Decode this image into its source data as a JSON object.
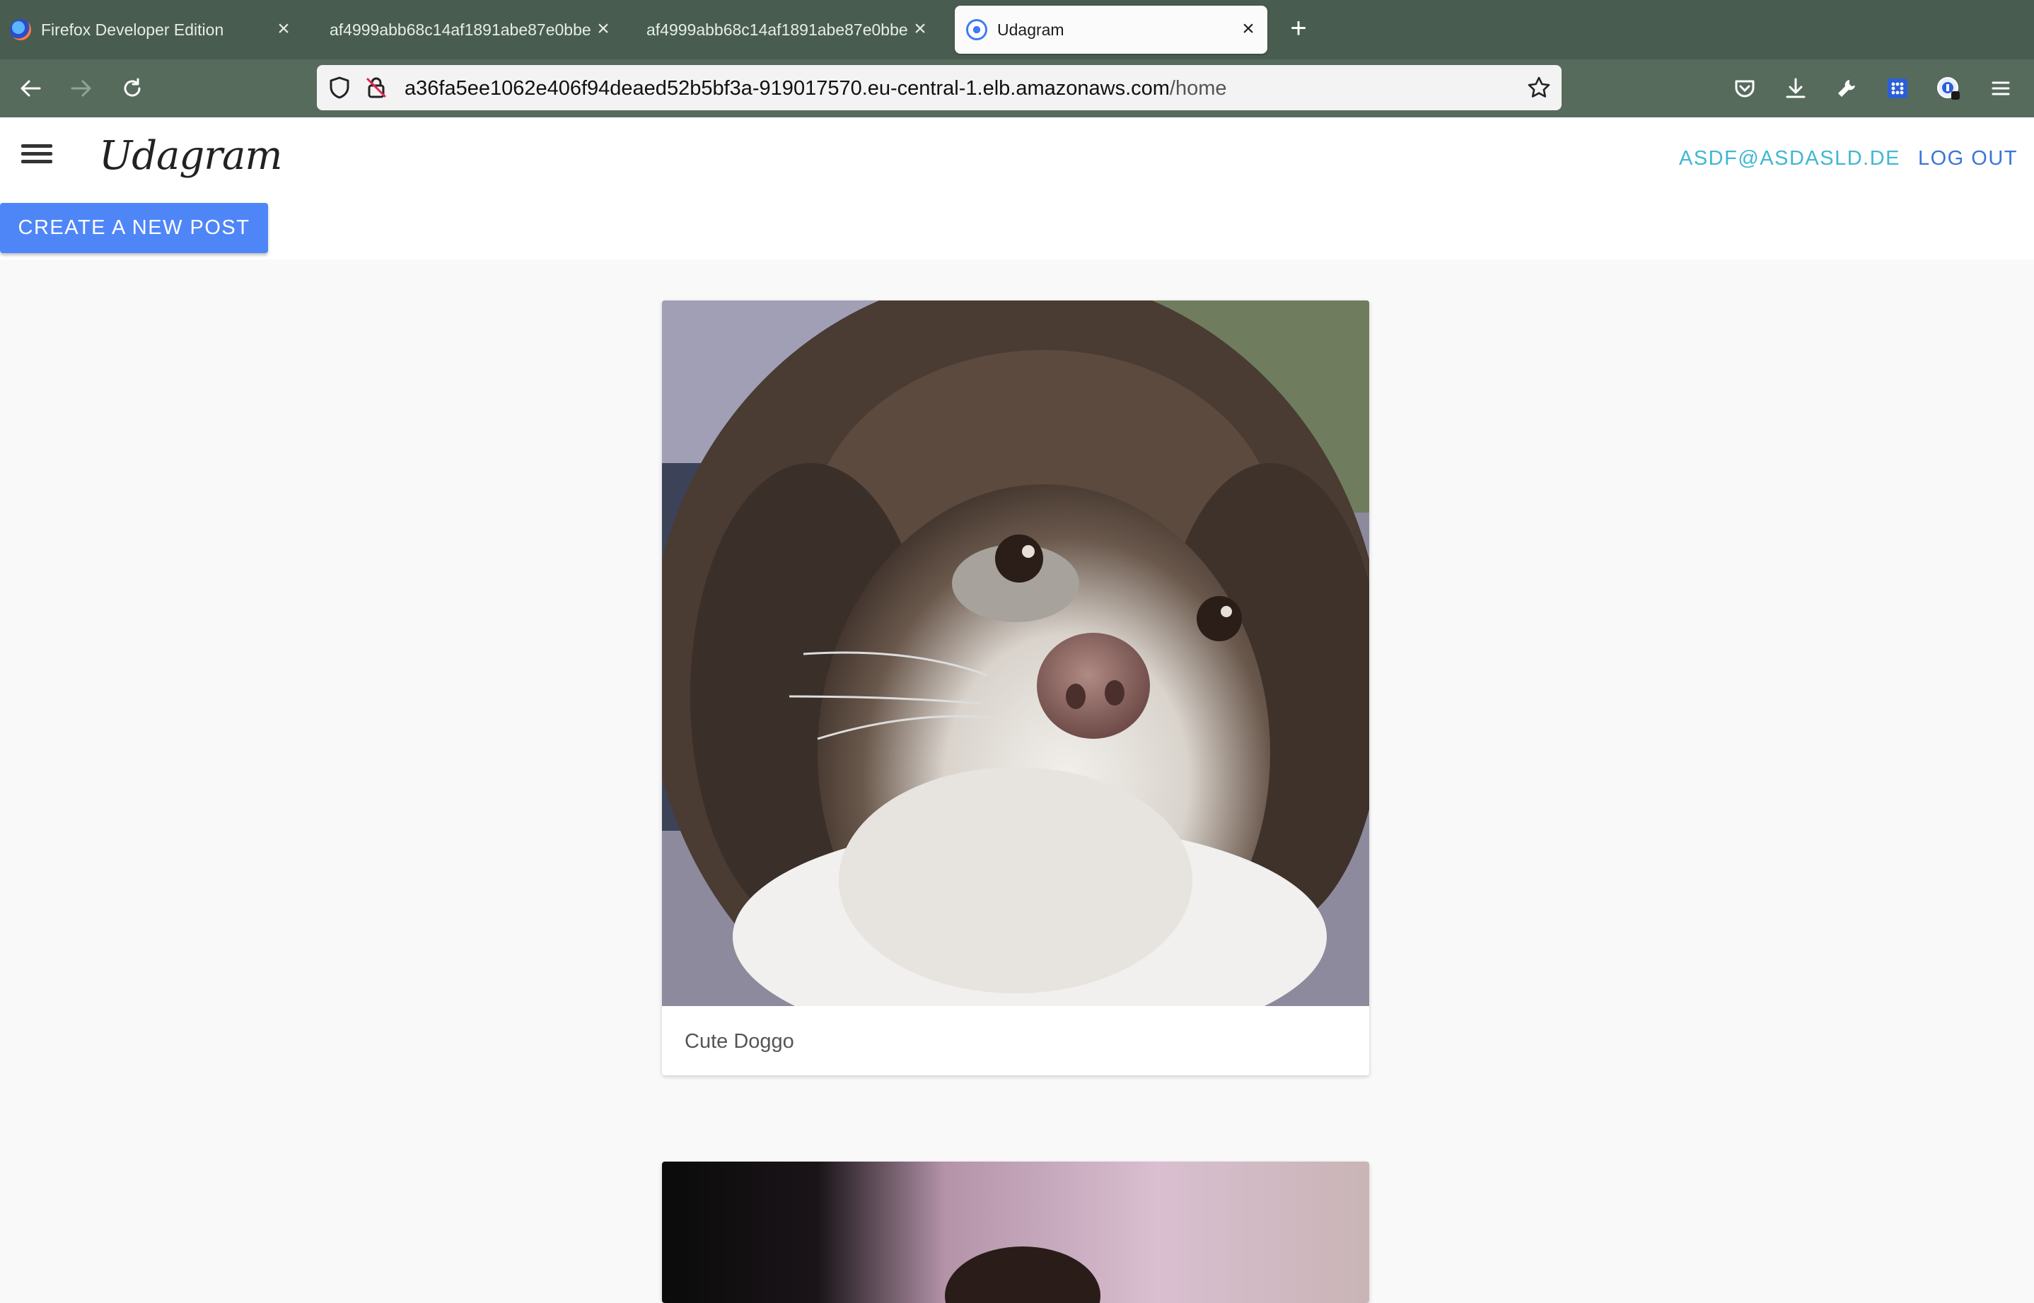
{
  "browser": {
    "tabs": [
      {
        "title": "Firefox Developer Edition",
        "active": false
      },
      {
        "title": "af4999abb68c14af1891abe87e0bbe",
        "active": false
      },
      {
        "title": "af4999abb68c14af1891abe87e0bbe",
        "active": false
      },
      {
        "title": "Udagram",
        "active": true
      }
    ],
    "new_tab_label": "+",
    "url_host": "a36fa5ee1062e406f94deaed52b5bf3a-919017570.eu-central-1.elb.amazonaws.com",
    "url_path": "/home"
  },
  "app": {
    "brand": "Udagram",
    "user_email": "ASDF@ASDASLD.DE",
    "logout_label": "LOG OUT",
    "create_post_label": "CREATE A NEW POST"
  },
  "feed": {
    "posts": [
      {
        "caption": "Cute Doggo"
      },
      {
        "caption": ""
      }
    ]
  },
  "colors": {
    "tabstrip": "#485d4f",
    "toolbar": "#566b5c",
    "primary_button": "#4f86f7",
    "email_link": "#41b7d5",
    "logout_link": "#3a74d9"
  }
}
